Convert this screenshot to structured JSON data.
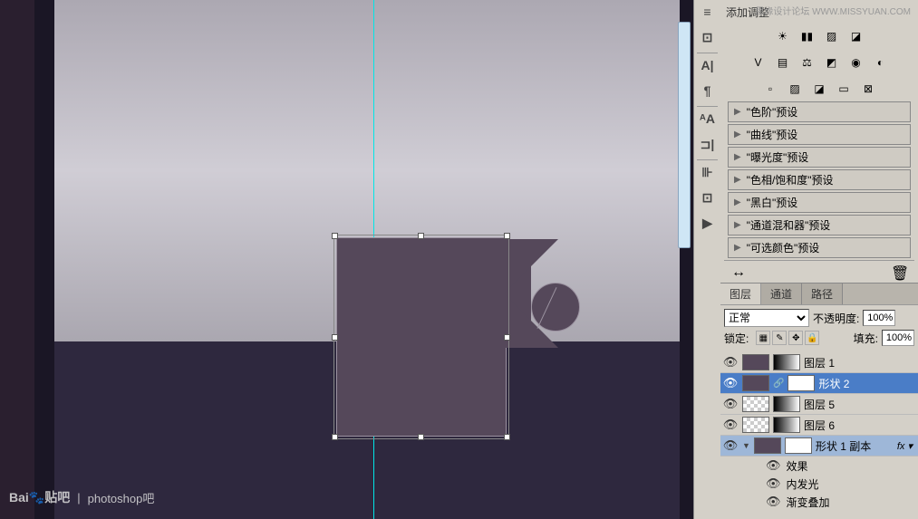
{
  "watermark": {
    "site": "思缘设计论坛",
    "url": "WWW.MISSYUAN.COM",
    "baidu": "Bai",
    "tieba": "贴吧",
    "forum": "photoshop吧"
  },
  "vtools": [
    "≡",
    "⊡",
    "A|",
    "¶",
    "",
    "ᴬA",
    "⊐|",
    "",
    "⊪",
    "⊡",
    "▶"
  ],
  "adjustments": {
    "title": "添加调整",
    "iconsRow1": [
      "☀",
      "▮▮",
      "▨",
      "◪"
    ],
    "iconsRow2": [
      "V",
      "▤",
      "⚖",
      "◩",
      "◉",
      "◐"
    ],
    "iconsRow3": [
      "▫",
      "▨",
      "◪",
      "▭",
      "⊠"
    ],
    "presets": [
      "\"色阶\"预设",
      "\"曲线\"预设",
      "\"曝光度\"预设",
      "\"色相/饱和度\"预设",
      "\"黑白\"预设",
      "\"通道混和器\"预设",
      "\"可选颜色\"预设"
    ]
  },
  "layersPanel": {
    "tabs": [
      "图层",
      "通道",
      "路径"
    ],
    "blendMode": "正常",
    "opacityLabel": "不透明度:",
    "opacityValue": "100%",
    "lockLabel": "锁定:",
    "fillLabel": "填充:",
    "fillValue": "100%",
    "layers": [
      {
        "name": "图层 1",
        "thumbClass": "shape",
        "hasMask": true,
        "maskClass": "gradient"
      },
      {
        "name": "形状 2",
        "thumbClass": "shape",
        "hasMask": true,
        "maskClass": "mask",
        "selected": true,
        "link": true
      },
      {
        "name": "图层 5",
        "thumbClass": "checker",
        "hasMask": true,
        "maskClass": "gradient"
      },
      {
        "name": "图层 6",
        "thumbClass": "checker",
        "hasMask": true,
        "maskClass": "gradient"
      }
    ],
    "group": {
      "name": "形状 1 副本",
      "thumbClass": "shape",
      "hasMask": true,
      "fx": "fx"
    },
    "fxLabel": "效果",
    "fxItems": [
      "内发光",
      "渐变叠加"
    ]
  }
}
